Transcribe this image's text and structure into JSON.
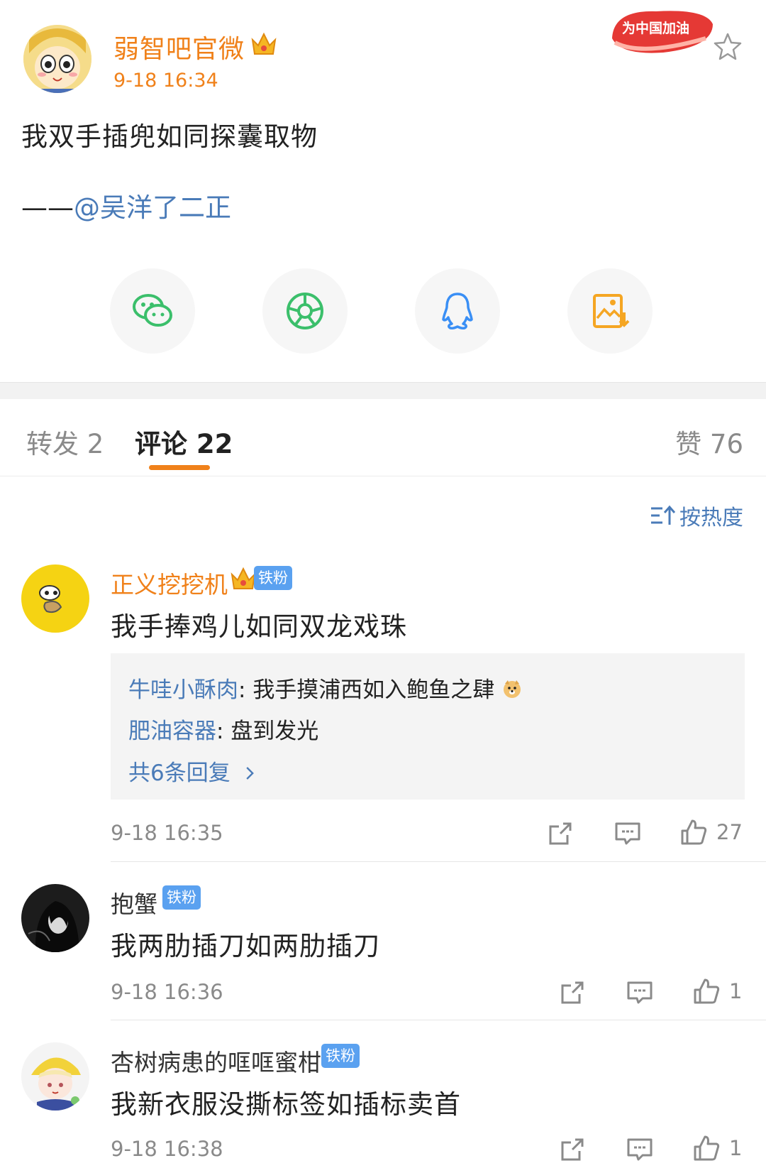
{
  "post": {
    "author": "弱智吧官微",
    "time": "9-18 16:34",
    "text": "我双手插兜如同探囊取物",
    "attribution_prefix": "——",
    "attribution_mention": "@吴洋了二正",
    "promo_badge": "为中国加油"
  },
  "share": {
    "items": [
      "wechat-icon",
      "moments-icon",
      "qq-icon",
      "save-image-icon"
    ]
  },
  "tabs": {
    "repost": "转发 2",
    "comment": "评论 22",
    "like": "赞 76"
  },
  "sort": {
    "label": "按热度"
  },
  "comments": [
    {
      "user": "正义挖挖机",
      "badge": "铁粉",
      "text": "我手捧鸡儿如同双龙戏珠",
      "replies": [
        {
          "user": "牛哇小酥肉",
          "sep": ": ",
          "text": "我手摸浦西如入鲍鱼之肆"
        },
        {
          "user": "肥油容器",
          "sep": ": ",
          "text": "盘到发光"
        }
      ],
      "more_replies": "共6条回复",
      "time": "9-18 16:35",
      "likes": "27"
    },
    {
      "user": "抱蟹",
      "badge": "铁粉",
      "text": "我两肋插刀如两肋插刀",
      "time": "9-18 16:36",
      "likes": "1"
    },
    {
      "user": "杏树病患的哐哐蜜柑",
      "badge": "铁粉",
      "text": "我新衣服没撕标签如插标卖首",
      "time": "9-18 16:38",
      "likes": "1"
    }
  ],
  "colors": {
    "accent": "#f0811a",
    "link": "#4a7bb8",
    "badge": "#5aa1f0",
    "muted": "#8a8a8a"
  }
}
